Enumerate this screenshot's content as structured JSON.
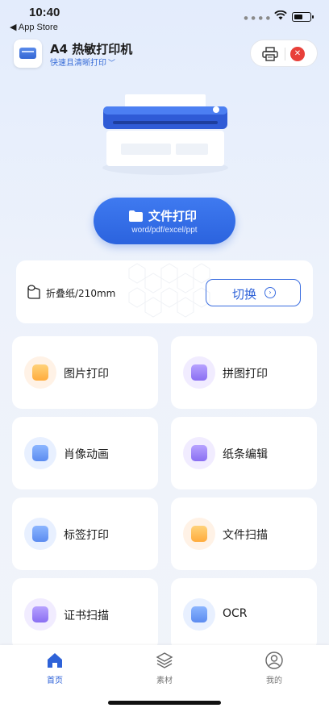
{
  "status_bar": {
    "time": "10:40",
    "back_label": "◀ App Store",
    "battery_level": 0.6
  },
  "header": {
    "app_title": "A4 热敏打印机",
    "app_subtitle": "快速且清晰打印",
    "subtitle_chevron": "chevron-down-icon",
    "printer_icon": "printer-icon",
    "close_icon": "close-icon",
    "close_glyph": "✕"
  },
  "main_action": {
    "label": "文件打印",
    "sub": "word/pdf/excel/ppt",
    "icon": "folder-icon"
  },
  "paper": {
    "label": "折叠纸/210mm",
    "switch_label": "切换",
    "switch_glyph": "›"
  },
  "features": [
    {
      "label": "图片打印",
      "icon": "image-icon",
      "color": "orange"
    },
    {
      "label": "拼图打印",
      "icon": "collage-icon",
      "color": "purple"
    },
    {
      "label": "肖像动画",
      "icon": "portrait-anim-icon",
      "color": "blue"
    },
    {
      "label": "纸条编辑",
      "icon": "note-edit-icon",
      "color": "purple"
    },
    {
      "label": "标签打印",
      "icon": "label-icon",
      "color": "blue"
    },
    {
      "label": "文件扫描",
      "icon": "doc-scan-icon",
      "color": "orange"
    },
    {
      "label": "证书扫描",
      "icon": "certificate-icon",
      "color": "purple"
    },
    {
      "label": "OCR",
      "icon": "ocr-icon",
      "color": "blue"
    }
  ],
  "tabs": [
    {
      "label": "首页",
      "icon": "home-icon",
      "active": true
    },
    {
      "label": "素材",
      "icon": "layers-icon",
      "active": false
    },
    {
      "label": "我的",
      "icon": "user-icon",
      "active": false
    }
  ],
  "colors": {
    "accent": "#2e62d8",
    "close": "#e8403a",
    "background": "#e9effa"
  }
}
